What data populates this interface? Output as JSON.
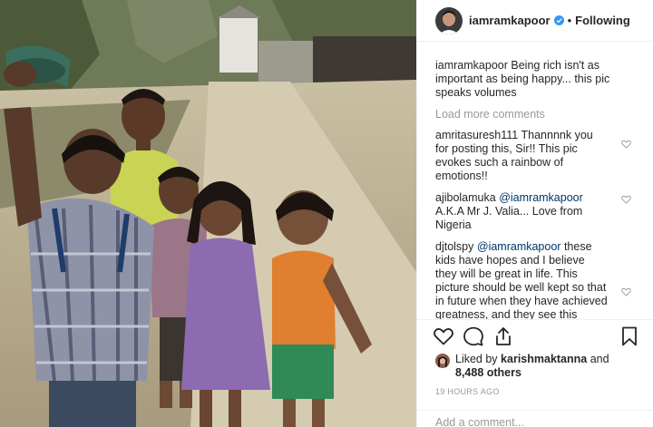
{
  "photo": {
    "subject": "children-selfie-photo"
  },
  "header": {
    "username": "iamramkapoor",
    "separator": "•",
    "follow_state": "Following"
  },
  "caption": {
    "username": "iamramkapoor",
    "text": "Being rich isn't as important as being happy... this pic speaks volumes"
  },
  "load_more": "Load more comments",
  "comments": [
    {
      "username": "amritasuresh111",
      "text": "Thannnnk you for posting this, Sir!! This pic evokes such a rainbow of emotions!!"
    },
    {
      "username": "ajibolamuka",
      "mention": "@iamramkapoor",
      "text": "A.K.A Mr J. Valia... Love from Nigeria"
    },
    {
      "username": "djtolspy",
      "mention": "@iamramkapoor",
      "text": "these kids have hopes and I believe they will be great in life. This picture should be well kept so that in future when they have achieved greatness, and they see this picture, they can always laugh over it and give God the glory. Happy Sunday sir!!!😂😌🌼"
    }
  ],
  "actions": {
    "like_icon": "heart-icon",
    "comment_icon": "comment-icon",
    "share_icon": "share-icon",
    "save_icon": "bookmark-icon"
  },
  "likes": {
    "prefix": "Liked by",
    "user": "karishmaktanna",
    "conj": "and",
    "others": "8,488 others"
  },
  "timestamp": "19 HOURS AGO",
  "add_comment_placeholder": "Add a comment..."
}
